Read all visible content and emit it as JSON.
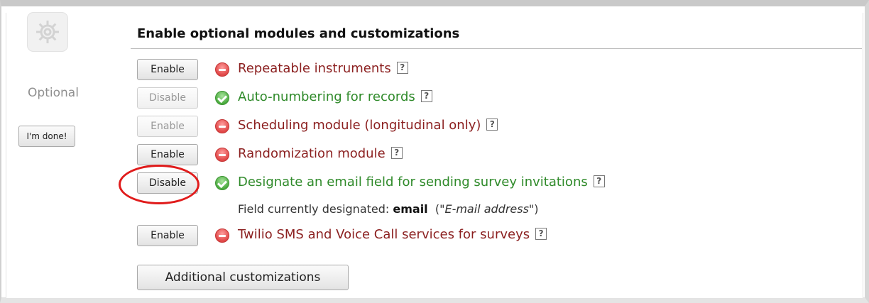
{
  "sidebar": {
    "optional_label": "Optional",
    "done_label": "I'm done!",
    "gear_icon": "gear-icon"
  },
  "section": {
    "title": "Enable optional modules and customizations"
  },
  "modules": [
    {
      "button": "Enable",
      "button_enabled": true,
      "status": "disabled",
      "label": "Repeatable instruments",
      "help": "?"
    },
    {
      "button": "Disable",
      "button_enabled": false,
      "status": "enabled",
      "label": "Auto-numbering for records",
      "help": "?"
    },
    {
      "button": "Enable",
      "button_enabled": false,
      "status": "disabled",
      "label": "Scheduling module (longitudinal only)",
      "help": "?"
    },
    {
      "button": "Enable",
      "button_enabled": true,
      "status": "disabled",
      "label": "Randomization module",
      "help": "?"
    },
    {
      "button": "Disable",
      "button_enabled": true,
      "status": "enabled",
      "label": "Designate an email field for sending survey invitations",
      "help": "?"
    },
    {
      "button": "Enable",
      "button_enabled": true,
      "status": "disabled",
      "label": "Twilio SMS and Voice Call services for surveys",
      "help": "?"
    }
  ],
  "email_field_note": {
    "prefix": "Field currently designated:",
    "field": "email",
    "open": "(\"",
    "field_label": "E-mail address",
    "close": "\")"
  },
  "additional_button": "Additional customizations",
  "colors": {
    "disabled_text": "#8b1f1f",
    "enabled_text": "#2f8a2a",
    "highlight_circle": "#e01b1b"
  }
}
